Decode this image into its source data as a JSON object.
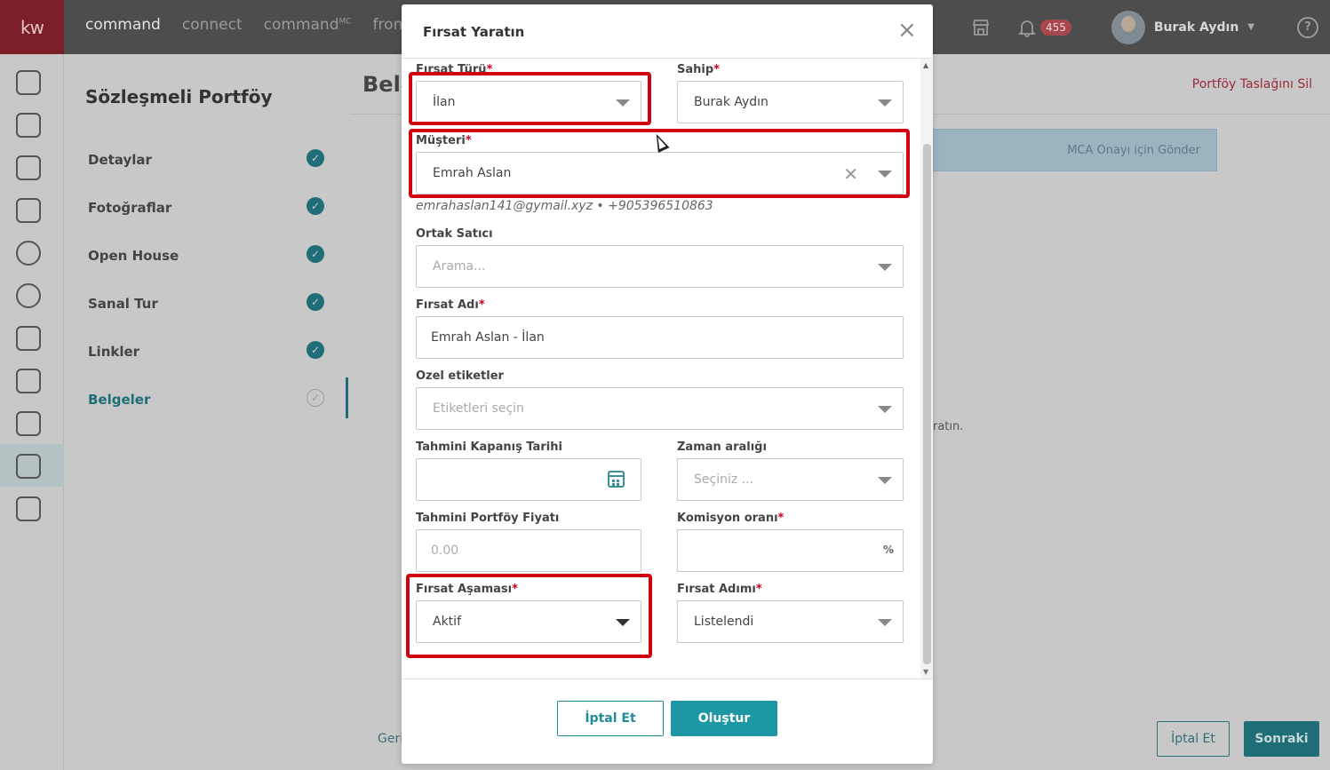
{
  "topbar": {
    "logo": "kw",
    "nav": [
      "command",
      "connect",
      "command",
      "fron"
    ],
    "nav_sup": "MC",
    "notification_count": "455",
    "user_name": "Burak Aydın",
    "help": "?"
  },
  "section_nav": {
    "title": "Sözleşmeli Portföy",
    "items": [
      {
        "label": "Detaylar"
      },
      {
        "label": "Fotoğraflar"
      },
      {
        "label": "Open House"
      },
      {
        "label": "Sanal Tur"
      },
      {
        "label": "Linkler"
      },
      {
        "label": "Belgeler"
      }
    ]
  },
  "main": {
    "page_title": "Belg",
    "delete_draft": "Portföy Taslağını Sil",
    "mca_button": "MCA Onayı için Gönder",
    "side_text": "ratın.",
    "back": "Geri",
    "cancel": "İptal Et",
    "next": "Sonraki"
  },
  "modal": {
    "title": "Fırsat Yaratın",
    "close": "×",
    "fields": {
      "firsat_turu": {
        "label": "Fırsat Türü",
        "value": "İlan"
      },
      "sahip": {
        "label": "Sahip",
        "value": "Burak Aydın"
      },
      "musteri": {
        "label": "Müşteri",
        "value": "Emrah Aslan",
        "contact": "emrahaslan141@gymail.xyz • +905396510863"
      },
      "ortak_satici": {
        "label": "Ortak Satıcı",
        "placeholder": "Arama..."
      },
      "firsat_adi": {
        "label": "Fırsat Adı",
        "value": "Emrah Aslan - İlan"
      },
      "ozel_etiketler": {
        "label": "Ozel etiketler",
        "placeholder": "Etiketleri seçin"
      },
      "tahmini_kapanis": {
        "label": "Tahmini Kapanış Tarihi",
        "value": ""
      },
      "zaman_araligi": {
        "label": "Zaman aralığı",
        "placeholder": "Seçiniz ..."
      },
      "tahmini_fiyat": {
        "label": "Tahmini Portföy Fiyatı",
        "placeholder": "0.00"
      },
      "komisyon": {
        "label": "Komisyon oranı",
        "suffix": "%"
      },
      "firsat_asamasi": {
        "label": "Fırsat Aşaması",
        "value": "Aktif"
      },
      "firsat_adimi": {
        "label": "Fırsat Adımı",
        "value": "Listelendi"
      }
    },
    "required_mark": "*",
    "cancel_button": "İptal Et",
    "create_button": "Oluştur"
  },
  "colors": {
    "accent": "#1d97a3",
    "highlight": "#d10010",
    "required": "#c8001e"
  }
}
